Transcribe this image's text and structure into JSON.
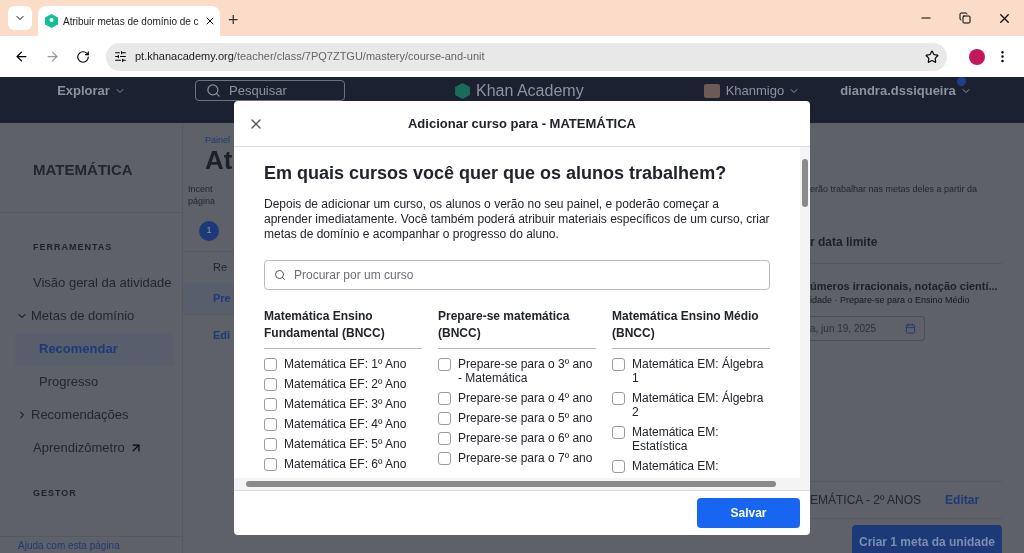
{
  "browser": {
    "tab": {
      "title": "Atribuir metas de domínio de c"
    },
    "new_tab": "+",
    "url_host": "pt.khanacademy.org",
    "url_path": "/teacher/class/7PQ7ZTGU/mastery/course-and-unit"
  },
  "header": {
    "explore": "Explorar",
    "search_placeholder": "Pesquisar",
    "logo": "Khan Academy",
    "khanmigo": "Khanmigo",
    "user": "diandra.dssiqueira",
    "notification_dot": true
  },
  "sidebar": {
    "title": "MATEMÁTICA",
    "sections": [
      {
        "heading": "FERRAMENTAS",
        "items": [
          {
            "label": "Visão geral da atividade",
            "kind": "link",
            "selected": false
          },
          {
            "label": "Metas de domínio",
            "kind": "group",
            "expanded": true,
            "children": [
              {
                "label": "Recomendar",
                "selected": true
              },
              {
                "label": "Progresso",
                "selected": false
              }
            ]
          },
          {
            "label": "Recomendações",
            "kind": "group",
            "expanded": false
          },
          {
            "label": "Aprendizômetro",
            "kind": "external",
            "selected": false
          }
        ]
      },
      {
        "heading": "GESTOR"
      }
    ],
    "help_link": "Ajuda com esta página"
  },
  "page_left": {
    "breadcrumb": "Painel",
    "title": "At",
    "intro": [
      "Incent",
      "página"
    ],
    "step": "1",
    "rows": [
      {
        "label": "Re",
        "selected": false
      },
      {
        "label": "Pre",
        "selected": true
      }
    ],
    "edit": "Edi"
  },
  "page_right": {
    "intro": "erão trabalhar nas metas deles a partir da",
    "column_heading": "r data limite",
    "unit_title": "úmeros irracionais, notação cientí...",
    "unit_meta": "idade · Prepare-se para o Ensino Médio",
    "due_date": "a, jun 19, 2025",
    "class_name": "EMÁTICA - 2º ANOS",
    "edit": "Editar",
    "create_button": "Criar 1 meta da unidade"
  },
  "modal": {
    "title": "Adicionar curso para - MATEMÁTICA",
    "heading": "Em quais cursos você quer que os alunos trabalhem?",
    "description": "Depois de adicionar um curso, os alunos o verão no seu painel, e poderão começar a aprender imediatamente. Você também poderá atribuir materiais específicos de um curso, criar metas de domínio e acompanhar o progresso do aluno.",
    "search_placeholder": "Procurar por um curso",
    "columns": [
      {
        "title": "Matemática Ensino Fundamental (BNCC)",
        "items": [
          {
            "label": "Matemática EF: 1º Ano",
            "checked": false
          },
          {
            "label": "Matemática EF: 2º Ano",
            "checked": false
          },
          {
            "label": "Matemática EF: 3º Ano",
            "checked": false
          },
          {
            "label": "Matemática EF: 4º Ano",
            "checked": false
          },
          {
            "label": "Matemática EF: 5º Ano",
            "checked": false
          },
          {
            "label": "Matemática EF: 6º Ano",
            "checked": false
          }
        ]
      },
      {
        "title": "Prepare-se matemática (BNCC)",
        "items": [
          {
            "label": "Prepare-se para o 3º ano - Matemática",
            "checked": false
          },
          {
            "label": "Prepare-se para o 4º ano",
            "checked": false
          },
          {
            "label": "Prepare-se para o 5º ano",
            "checked": false
          },
          {
            "label": "Prepare-se para o 6º ano",
            "checked": false
          },
          {
            "label": "Prepare-se para o 7º ano",
            "checked": false
          }
        ]
      },
      {
        "title": "Matemática Ensino Médio (BNCC)",
        "items": [
          {
            "label": "Matemática EM: Álgebra 1",
            "checked": false
          },
          {
            "label": "Matemática EM: Álgebra 2",
            "checked": false
          },
          {
            "label": "Matemática EM: Estatística",
            "checked": false
          },
          {
            "label": "Matemática EM:",
            "checked": false
          }
        ]
      }
    ],
    "save": "Salvar"
  }
}
